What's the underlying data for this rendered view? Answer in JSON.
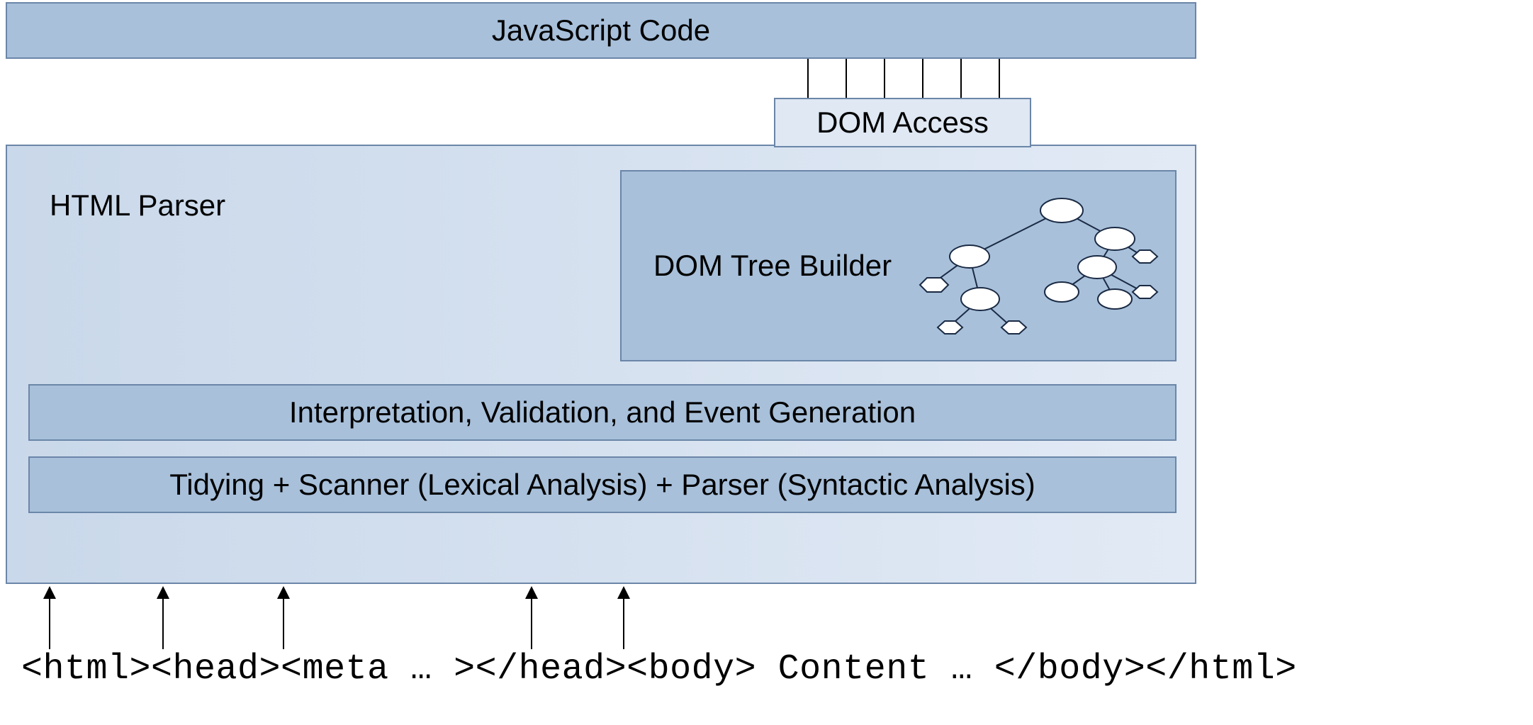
{
  "boxes": {
    "js_code": "JavaScript Code",
    "dom_access": "DOM Access",
    "html_parser": "HTML Parser",
    "dom_tree_builder": "DOM Tree Builder",
    "interpretation": "Interpretation, Validation, and Event Generation",
    "tidying": "Tidying + Scanner (Lexical Analysis) + Parser (Syntactic Analysis)"
  },
  "html_input": "<html><head><meta … ></head><body> Content … </body></html>"
}
